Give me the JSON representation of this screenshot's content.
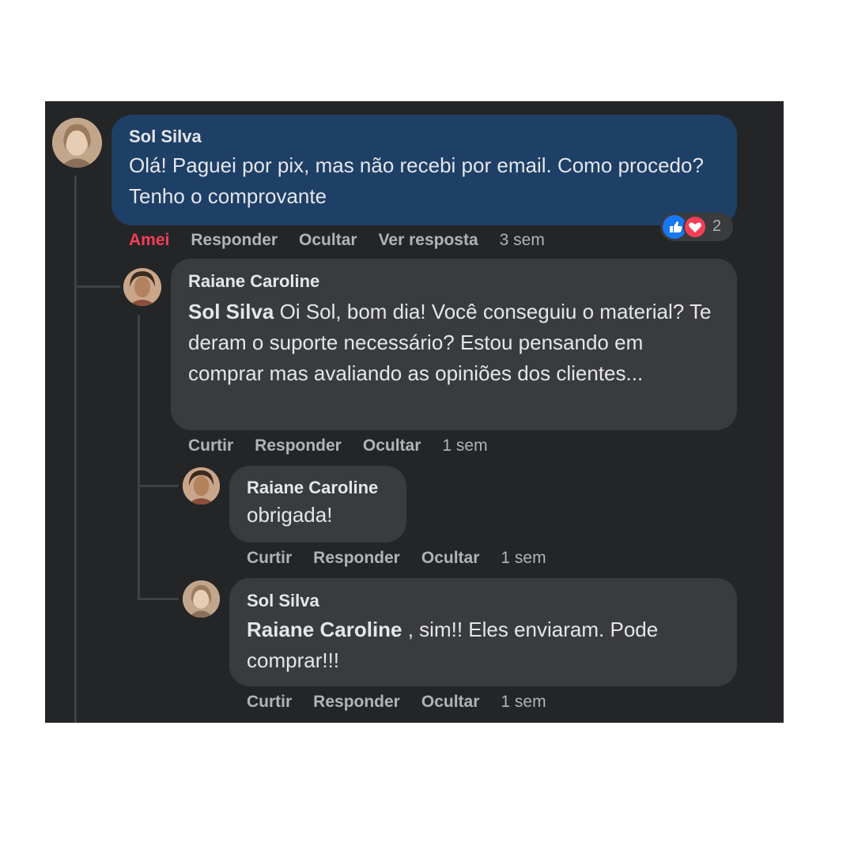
{
  "comment": {
    "author": "Sol Silva",
    "text": "Olá! Paguei por pix, mas não recebi por email. Como procedo? Tenho o comprovante",
    "actions": {
      "react": "Amei",
      "reply": "Responder",
      "hide": "Ocultar",
      "view_reply": "Ver resposta",
      "time": "3 sem"
    },
    "reactions": {
      "count": "2",
      "types": [
        "like",
        "love"
      ],
      "colors": {
        "like": "#1877f2",
        "love": "#f33e58"
      }
    }
  },
  "replies": [
    {
      "author": "Raiane Caroline",
      "mention": "Sol Silva",
      "text": " Oi Sol, bom dia! Você conseguiu o material? Te deram o suporte necessário? Estou pensando em comprar mas avaliando as opiniões dos clientes...",
      "actions": {
        "like": "Curtir",
        "reply": "Responder",
        "hide": "Ocultar",
        "time": "1 sem"
      }
    },
    {
      "author": "Raiane Caroline",
      "text": "obrigada!",
      "actions": {
        "like": "Curtir",
        "reply": "Responder",
        "hide": "Ocultar",
        "time": "1 sem"
      }
    },
    {
      "author": "Sol Silva",
      "mention": "Raiane Caroline",
      "text": " , sim!! Eles enviaram. Pode comprar!!!",
      "actions": {
        "like": "Curtir",
        "reply": "Responder",
        "hide": "Ocultar",
        "time": "1 sem"
      }
    }
  ],
  "colors": {
    "panel": "#242526",
    "bubble": "#3a3b3c",
    "highlight_bubble": "#1e3f66",
    "secondary_text": "#b0b3b8",
    "love_text": "#f33e58"
  }
}
